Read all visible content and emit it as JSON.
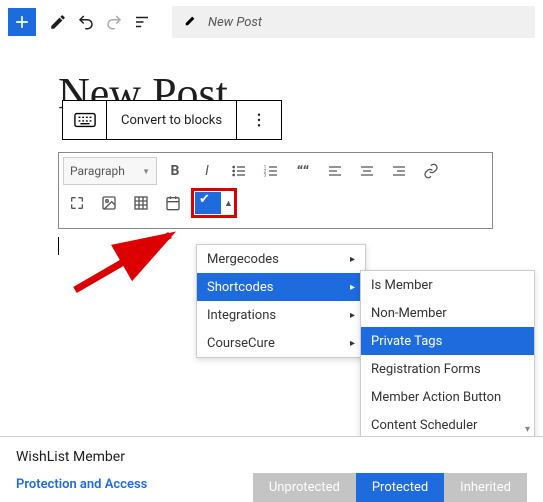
{
  "topbar": {
    "title": "New Post"
  },
  "postTitle": "New Post",
  "blockToolbar": {
    "convert": "Convert to blocks"
  },
  "classic": {
    "paragraph": "Paragraph"
  },
  "menu1": {
    "items": [
      {
        "label": "Mergecodes"
      },
      {
        "label": "Shortcodes"
      },
      {
        "label": "Integrations"
      },
      {
        "label": "CourseCure"
      }
    ]
  },
  "menu2": {
    "items": [
      {
        "label": "Is Member"
      },
      {
        "label": "Non-Member"
      },
      {
        "label": "Private Tags"
      },
      {
        "label": "Registration Forms"
      },
      {
        "label": "Member Action Button"
      },
      {
        "label": "Content Scheduler"
      }
    ]
  },
  "wl": {
    "title": "WishList Member",
    "tab": "Protection and Access",
    "buttons": {
      "un": "Unprotected",
      "pr": "Protected",
      "in": "Inherited"
    }
  }
}
